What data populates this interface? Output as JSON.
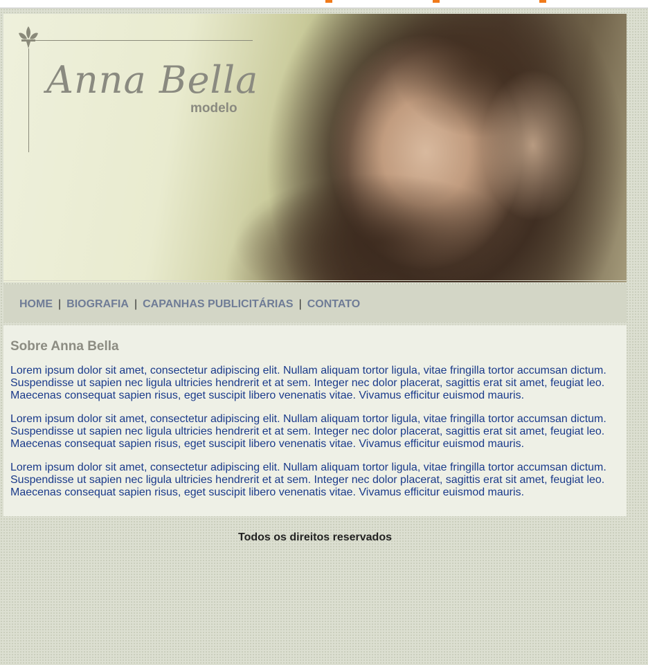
{
  "logo": {
    "name": "Anna Bella",
    "subtitle": "modelo"
  },
  "nav": {
    "items": [
      {
        "label": "HOME"
      },
      {
        "label": "BIOGRAFIA"
      },
      {
        "label": "CAPANHAS PUBLICITÁRIAS"
      },
      {
        "label": "CONTATO"
      }
    ],
    "separator": "|"
  },
  "content": {
    "heading": "Sobre Anna Bella",
    "paragraphs": [
      "Lorem ipsum dolor sit amet, consectetur adipiscing elit. Nullam aliquam tortor ligula, vitae fringilla tortor accumsan dictum. Suspendisse ut sapien nec ligula ultricies hendrerit et at sem. Integer nec dolor placerat, sagittis erat sit amet, feugiat leo. Maecenas consequat sapien risus, eget suscipit libero venenatis vitae. Vivamus efficitur euismod mauris.",
      "Lorem ipsum dolor sit amet, consectetur adipiscing elit. Nullam aliquam tortor ligula, vitae fringilla tortor accumsan dictum. Suspendisse ut sapien nec ligula ultricies hendrerit et at sem. Integer nec dolor placerat, sagittis erat sit amet, feugiat leo. Maecenas consequat sapien risus, eget suscipit libero venenatis vitae. Vivamus efficitur euismod mauris.",
      "Lorem ipsum dolor sit amet, consectetur adipiscing elit. Nullam aliquam tortor ligula, vitae fringilla tortor accumsan dictum. Suspendisse ut sapien nec ligula ultricies hendrerit et at sem. Integer nec dolor placerat, sagittis erat sit amet, feugiat leo. Maecenas consequat sapien risus, eget suscipit libero venenatis vitae. Vivamus efficitur euismod mauris."
    ]
  },
  "footer": {
    "text": "Todos os direitos reservados"
  },
  "colors": {
    "nav_link": "#6f7c96",
    "body_text": "#1a3a8a",
    "heading": "#8c8c82",
    "page_bg": "#dcdfd1",
    "content_bg": "#eef0e6",
    "nav_bg": "#d3d6c6",
    "rss_accent": "#f07a1a"
  },
  "icons": [
    "rss-icon",
    "fleur-de-lis-icon"
  ]
}
